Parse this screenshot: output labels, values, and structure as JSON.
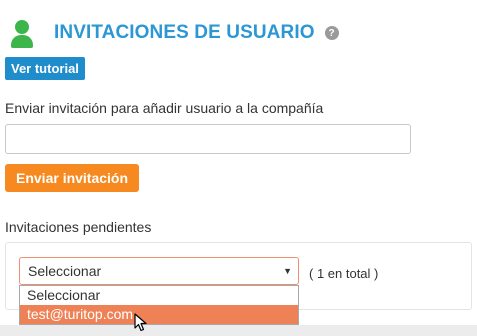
{
  "header": {
    "title": "INVITACIONES DE USUARIO",
    "user_icon": "user-icon",
    "help_icon": "question-circle-icon",
    "help_glyph": "?"
  },
  "tutorial_button": {
    "label": "Ver tutorial"
  },
  "invite": {
    "label": "Enviar invitación para añadir usuario a la compañía",
    "input_value": "",
    "send_label": "Enviar invitación"
  },
  "pending": {
    "label": "Invitaciones pendientes",
    "select_value": "Seleccionar",
    "count_text": "( 1 en total )",
    "options": [
      "Seleccionar",
      "test@turitop.com"
    ],
    "highlighted_option": "test@turitop.com"
  },
  "colors": {
    "title": "#2b97d3",
    "user_icon": "#3cb64a",
    "tutorial_button": "#1f8ccc",
    "send_button": "#f6891f",
    "option_highlight": "#ee8256"
  }
}
